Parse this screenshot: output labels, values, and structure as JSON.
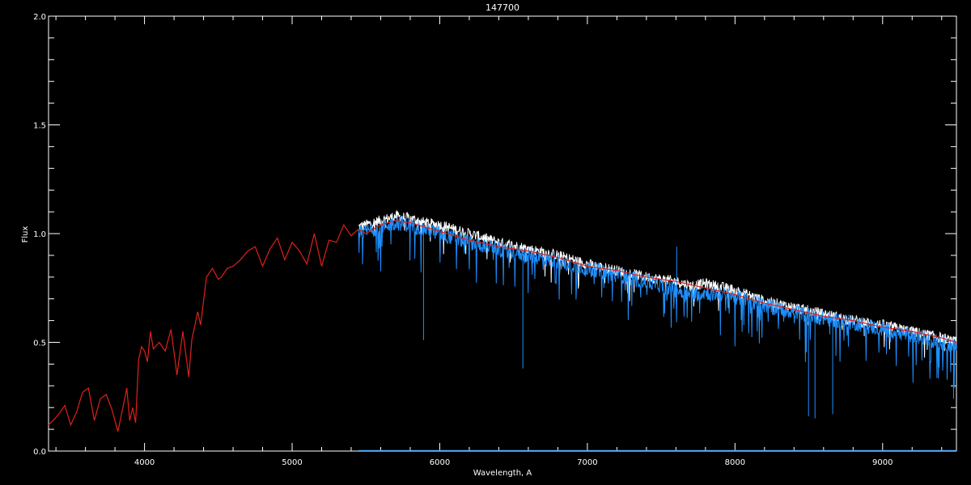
{
  "chart_data": {
    "type": "line",
    "title": "147700",
    "xlabel": "Wavelength, A",
    "ylabel": "Flux",
    "xlim": [
      3350,
      9500
    ],
    "ylim": [
      0.0,
      2.0
    ],
    "x_ticks": [
      4000,
      5000,
      6000,
      7000,
      8000,
      9000
    ],
    "x_tick_labels": [
      "4000",
      "5000",
      "6000",
      "7000",
      "8000",
      "9000"
    ],
    "y_ticks": [
      0.0,
      0.5,
      1.0,
      1.5,
      2.0
    ],
    "y_tick_labels": [
      "0.0",
      "0.5",
      "1.0",
      "1.5",
      "2.0"
    ],
    "grid": false,
    "background": "#000000",
    "series": [
      {
        "color": "#ffffff",
        "style": "observed-spectrum-white",
        "x": [
          5450,
          5600,
          5700,
          5800,
          5900,
          6000,
          6200,
          6400,
          6600,
          6800,
          7000,
          7200,
          7400,
          7600,
          7700,
          7800,
          8000,
          8200,
          8400,
          8600,
          8800,
          9000,
          9200,
          9400,
          9500
        ],
        "values": [
          1.03,
          1.06,
          1.08,
          1.07,
          1.05,
          1.04,
          1.0,
          0.96,
          0.93,
          0.9,
          0.86,
          0.83,
          0.8,
          0.78,
          0.76,
          0.77,
          0.74,
          0.69,
          0.66,
          0.63,
          0.6,
          0.58,
          0.55,
          0.52,
          0.5
        ]
      },
      {
        "color": "#1e90ff",
        "style": "observed-spectrum-blue",
        "x": [
          5450,
          5600,
          5700,
          5800,
          5900,
          6000,
          6200,
          6400,
          6600,
          6800,
          7000,
          7200,
          7400,
          7600,
          7700,
          7800,
          8000,
          8200,
          8400,
          8600,
          8800,
          9000,
          9200,
          9400,
          9500
        ],
        "values": [
          1.0,
          1.03,
          1.05,
          1.04,
          1.02,
          1.0,
          0.96,
          0.93,
          0.9,
          0.87,
          0.84,
          0.81,
          0.78,
          0.74,
          0.72,
          0.73,
          0.71,
          0.67,
          0.64,
          0.61,
          0.59,
          0.56,
          0.53,
          0.5,
          0.48
        ],
        "absorption_lines": [
          {
            "x": 5890,
            "min": 0.51
          },
          {
            "x": 6563,
            "min": 0.38
          },
          {
            "x": 8498,
            "min": 0.16
          },
          {
            "x": 8542,
            "min": 0.15
          },
          {
            "x": 8662,
            "min": 0.17
          },
          {
            "x": 9480,
            "min": 0.24
          }
        ],
        "emission_lines": [
          {
            "x": 7605,
            "max": 0.94
          }
        ]
      },
      {
        "color": "#e0201a",
        "style": "model-spectrum",
        "x": [
          3350,
          3380,
          3420,
          3460,
          3500,
          3540,
          3580,
          3620,
          3660,
          3700,
          3740,
          3780,
          3820,
          3860,
          3880,
          3900,
          3920,
          3940,
          3960,
          3980,
          4000,
          4020,
          4040,
          4060,
          4100,
          4140,
          4180,
          4220,
          4260,
          4300,
          4320,
          4360,
          4380,
          4420,
          4460,
          4500,
          4520,
          4560,
          4600,
          4650,
          4700,
          4750,
          4800,
          4850,
          4900,
          4950,
          5000,
          5050,
          5100,
          5150,
          5200,
          5250,
          5300,
          5350,
          5400,
          5450,
          5500,
          5600,
          5700,
          5800,
          5900,
          6000,
          6200,
          6400,
          6600,
          6800,
          7000,
          7200,
          7400,
          7600,
          7800,
          8000,
          8200,
          8400,
          8600,
          8800,
          9000,
          9200,
          9400,
          9500
        ],
        "values": [
          0.12,
          0.14,
          0.17,
          0.21,
          0.12,
          0.18,
          0.27,
          0.29,
          0.14,
          0.24,
          0.26,
          0.19,
          0.09,
          0.22,
          0.29,
          0.14,
          0.2,
          0.13,
          0.42,
          0.48,
          0.46,
          0.41,
          0.55,
          0.47,
          0.5,
          0.46,
          0.56,
          0.35,
          0.55,
          0.34,
          0.51,
          0.64,
          0.58,
          0.8,
          0.84,
          0.79,
          0.8,
          0.84,
          0.85,
          0.88,
          0.92,
          0.94,
          0.85,
          0.93,
          0.98,
          0.88,
          0.96,
          0.92,
          0.86,
          1.0,
          0.85,
          0.97,
          0.96,
          1.04,
          0.99,
          1.02,
          1.0,
          1.04,
          1.06,
          1.05,
          1.03,
          1.01,
          0.97,
          0.94,
          0.92,
          0.89,
          0.85,
          0.83,
          0.8,
          0.78,
          0.75,
          0.72,
          0.68,
          0.65,
          0.62,
          0.6,
          0.57,
          0.55,
          0.52,
          0.5
        ]
      }
    ]
  }
}
